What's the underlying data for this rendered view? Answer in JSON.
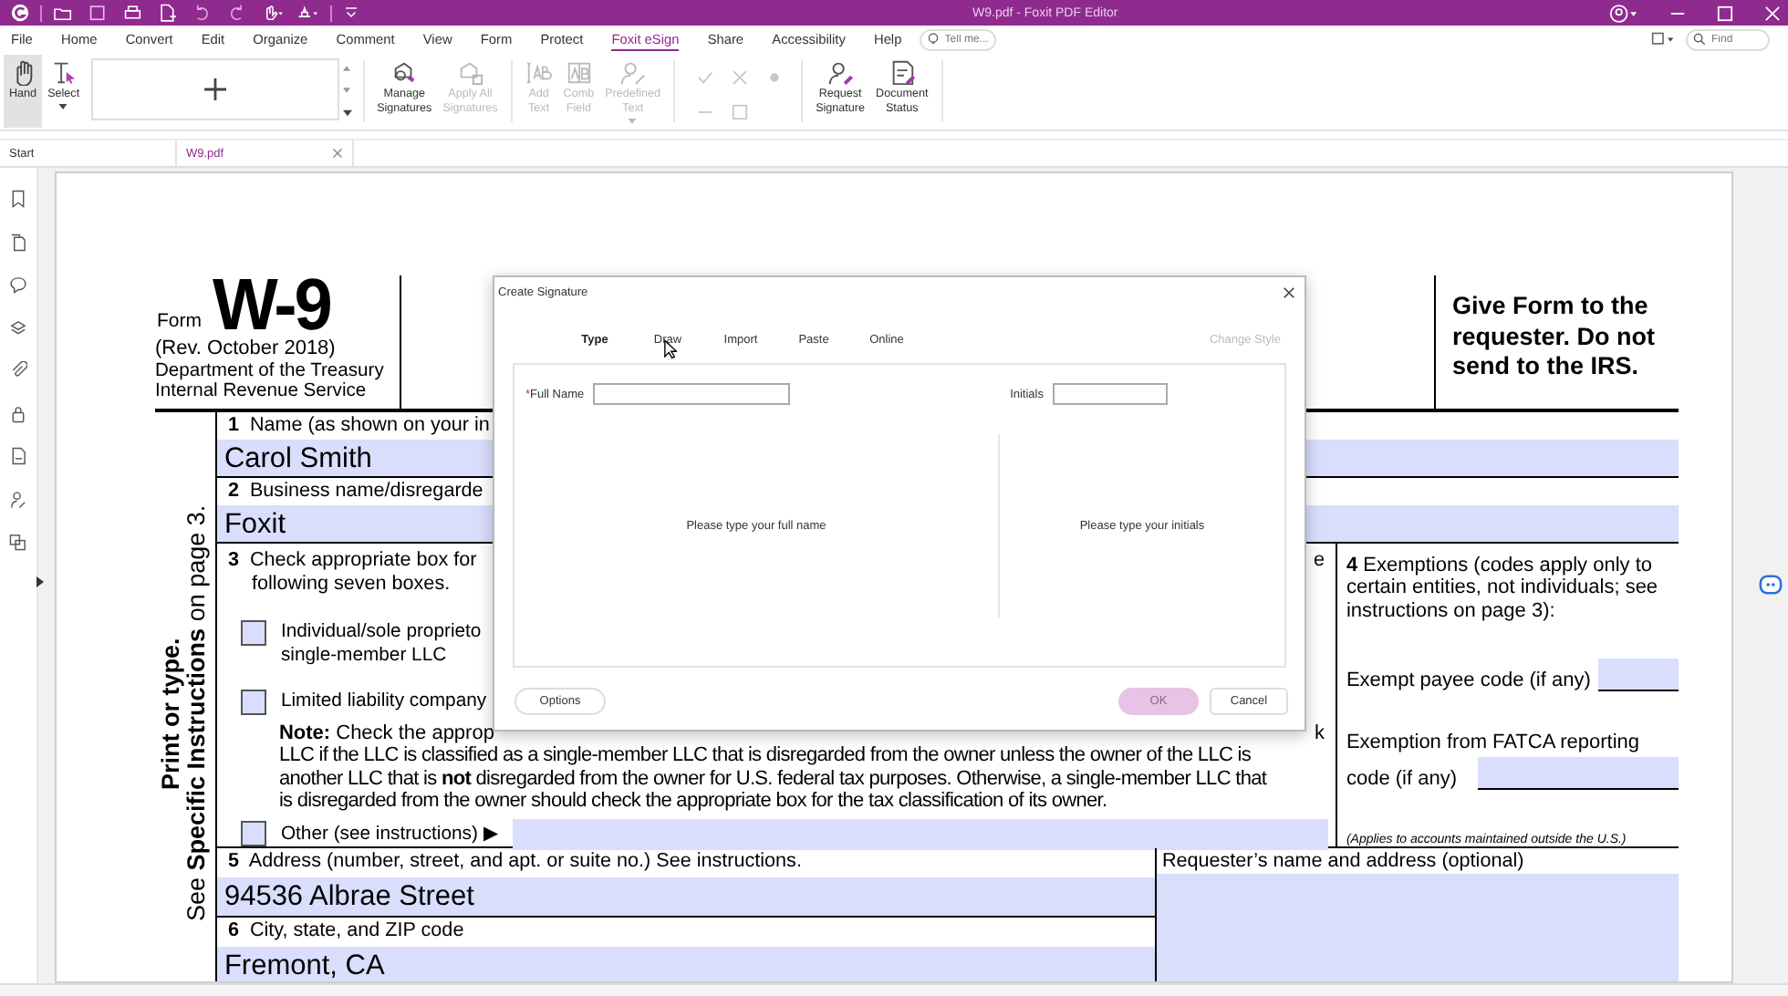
{
  "window": {
    "title": "W9.pdf - Foxit PDF Editor"
  },
  "menu": [
    {
      "label": "File",
      "selected": false
    },
    {
      "label": "Home",
      "selected": false
    },
    {
      "label": "Convert",
      "selected": false
    },
    {
      "label": "Edit",
      "selected": false
    },
    {
      "label": "Organize",
      "selected": false
    },
    {
      "label": "Comment",
      "selected": false
    },
    {
      "label": "View",
      "selected": false
    },
    {
      "label": "Form",
      "selected": false
    },
    {
      "label": "Protect",
      "selected": false
    },
    {
      "label": "Foxit eSign",
      "selected": true
    },
    {
      "label": "Share",
      "selected": false
    },
    {
      "label": "Accessibility",
      "selected": false
    },
    {
      "label": "Help",
      "selected": false
    }
  ],
  "tell_me": {
    "placeholder": "Tell me..."
  },
  "find": {
    "placeholder": "Find"
  },
  "ribbon_groups": [
    [
      {
        "label": "Hand",
        "selected": true,
        "disabled": false,
        "has_menu": false
      },
      {
        "label": "Select",
        "selected": false,
        "disabled": false,
        "has_menu": true
      }
    ],
    [
      {
        "label": "Manage\nSignatures",
        "selected": false,
        "disabled": false,
        "has_menu": false
      },
      {
        "label": "Apply All\nSignatures",
        "selected": false,
        "disabled": true,
        "has_menu": false
      }
    ],
    [
      {
        "label": "Add\nText",
        "selected": false,
        "disabled": true,
        "has_menu": false
      },
      {
        "label": "Comb\nField",
        "selected": false,
        "disabled": true,
        "has_menu": false
      },
      {
        "label": "Predefined\nText",
        "selected": false,
        "disabled": true,
        "has_menu": true
      }
    ],
    [
      {
        "label": "Request\nSignature",
        "selected": false,
        "disabled": false,
        "has_menu": false
      },
      {
        "label": "Document\nStatus",
        "selected": false,
        "disabled": false,
        "has_menu": false
      }
    ]
  ],
  "doc_tabs": [
    {
      "label": "Start",
      "selected": false,
      "closable": false
    },
    {
      "label": "W9.pdf",
      "selected": true,
      "closable": true
    }
  ],
  "form": {
    "form_label": "Form",
    "number": "W-9",
    "revision": "(Rev. October 2018)",
    "agency": [
      "Department of the Treasury",
      "Internal Revenue Service"
    ],
    "notice": "Give Form to the requester. Do not send to the IRS.",
    "side_lines": [
      "Print or type.",
      "See **Specific Instructions** on page 3."
    ],
    "line1": {
      "number": "1",
      "label": "Name (as shown on your in",
      "value": "Carol Smith"
    },
    "line2": {
      "number": "2",
      "label": "Business name/disregarde",
      "value": "Foxit"
    },
    "line3": {
      "number": "3",
      "text": [
        "Check appropriate box for",
        "following seven boxes."
      ],
      "tail": "e",
      "checkboxes": [
        {
          "label": "Individual/sole proprieto\nsingle-member LLC",
          "checked": false
        },
        {
          "label": "Limited liability company",
          "checked": false
        }
      ],
      "note_lines": [
        "**Note:** Check the approp",
        "LLC if the LLC is classified as a single-member LLC that is disregarded from the owner unless the owner of the LLC is",
        "another LLC that is **not** disregarded from the owner for U.S. federal tax purposes. Otherwise, a single-member LLC that",
        "is disregarded from the owner should check the appropriate box for the tax classification of its owner."
      ],
      "note_tail": "k",
      "other": {
        "label": "Other (see instructions) ▶",
        "checked": false
      }
    },
    "line4": {
      "heading": "**4** Exemptions (codes apply only to certain entities, not individuals; see instructions on page 3):",
      "payee": "Exempt payee code (if any)",
      "fatca": [
        "Exemption from FATCA reporting",
        "code (if any)"
      ],
      "footnote": "(Applies to accounts maintained outside the U.S.)"
    },
    "line5": {
      "number": "5",
      "label": "Address (number, street, and apt. or suite no.) See instructions.",
      "value": "94536 Albrae Street"
    },
    "line6": {
      "number": "6",
      "label": "City, state, and ZIP code",
      "value": "Fremont, CA"
    },
    "requester": "Requester’s name and address (optional)"
  },
  "dialog": {
    "title": "Create Signature",
    "tabs": [
      {
        "label": "Type",
        "selected": true
      },
      {
        "label": "Draw",
        "selected": false
      },
      {
        "label": "Import",
        "selected": false
      },
      {
        "label": "Paste",
        "selected": false
      },
      {
        "label": "Online",
        "selected": false
      }
    ],
    "change_style": {
      "label": "Change Style",
      "disabled": true
    },
    "full_name": {
      "required_mark": "*",
      "label": "Full Name"
    },
    "initials": {
      "label": "Initials"
    },
    "full_name_hint": "Please type your full name",
    "initials_hint": "Please type your initials",
    "buttons": [
      {
        "label": "Options",
        "kind": "secondary",
        "disabled": false
      },
      {
        "label": "OK",
        "kind": "primary",
        "disabled": true
      },
      {
        "label": "Cancel",
        "kind": "secondary",
        "disabled": false
      }
    ]
  }
}
